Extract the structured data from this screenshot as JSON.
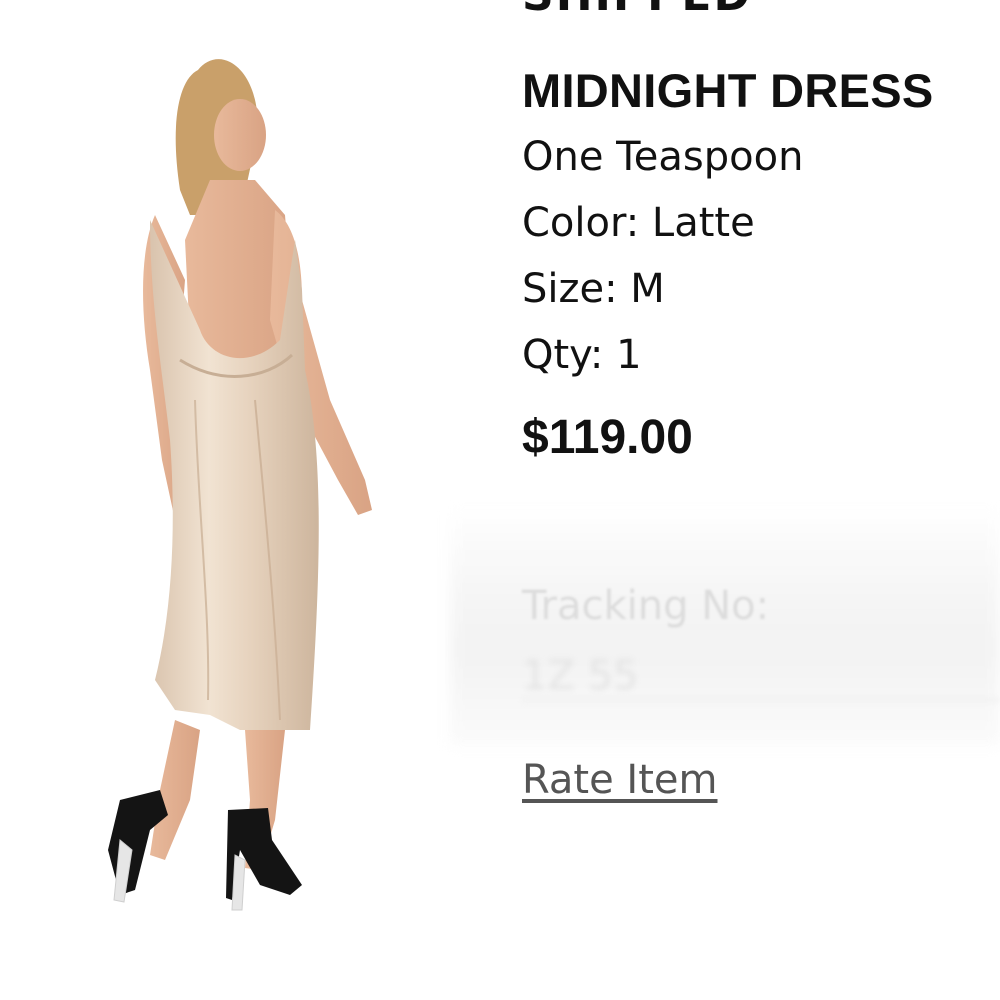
{
  "order": {
    "status_label": "SHIPPED"
  },
  "item": {
    "name": "MIDNIGHT DRESS",
    "brand": "One Teaspoon",
    "color_line": "Color: Latte",
    "size_line": "Size: M",
    "qty_line": "Qty: 1",
    "price": "$119.00",
    "image_icon": "product-photo"
  },
  "tracking": {
    "label": "Tracking No:",
    "number_visible": "1Z                                55"
  },
  "actions": {
    "rate_label": "Rate Item"
  },
  "colors": {
    "dress": "#e7d6c4",
    "text": "#111111",
    "link": "#555555"
  }
}
